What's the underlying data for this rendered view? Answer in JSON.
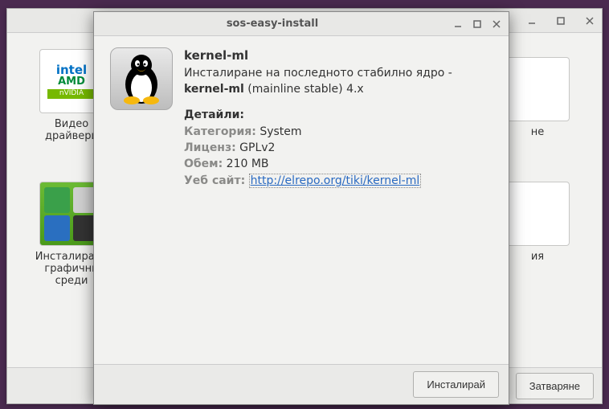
{
  "windowTitle": "sos-easy-install",
  "bgItems": {
    "driversLabel": "Видео драйвери",
    "graphicsLabel": "Инсталиране графични среди"
  },
  "rightItems": {
    "topPartial": "не",
    "botPartial": "ия"
  },
  "app": {
    "iconName": "tux-icon",
    "name": "kernel-ml",
    "descPrefix": "Инсталиране на последното стабилно ядро - ",
    "descBold": "kernel-ml",
    "descSuffix": " (mainline stable) 4.x",
    "detailsHeading": "Детайли:",
    "categoryLabel": "Категория:",
    "categoryValue": "System",
    "licenseLabel": "Лиценз:",
    "licenseValue": "GPLv2",
    "sizeLabel": "Обем:",
    "sizeValue": "210 MB",
    "webLabel": "Уеб сайт:",
    "webUrl": "http://elrepo.org/tiki/kernel-ml"
  },
  "buttons": {
    "install": "Инсталирай",
    "close": "Затваряне"
  }
}
